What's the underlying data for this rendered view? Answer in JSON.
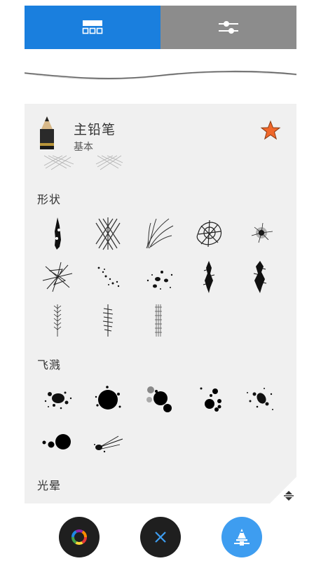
{
  "tabs": [
    {
      "name": "brush-library",
      "icon": "grid-icon",
      "active": true
    },
    {
      "name": "brush-settings",
      "icon": "sliders-icon",
      "active": false
    }
  ],
  "brush": {
    "name": "主铅笔",
    "category": "基本",
    "favorite": true,
    "icon": "pencil-icon"
  },
  "sections": [
    {
      "title": "形状",
      "count": 13
    },
    {
      "title": "飞溅",
      "count": 7
    },
    {
      "title": "光晕"
    }
  ],
  "colors": {
    "accent": "#1a7fde",
    "tab_inactive": "#8c8c8c",
    "star": "#f0672a",
    "fab_dark": "#1f1f1f",
    "fab_blue": "#3e9df0",
    "panel_bg": "#f0f0f0"
  },
  "bottom_bar": {
    "buttons": [
      "color-wheel-icon",
      "close-icon",
      "brush-icon"
    ]
  }
}
